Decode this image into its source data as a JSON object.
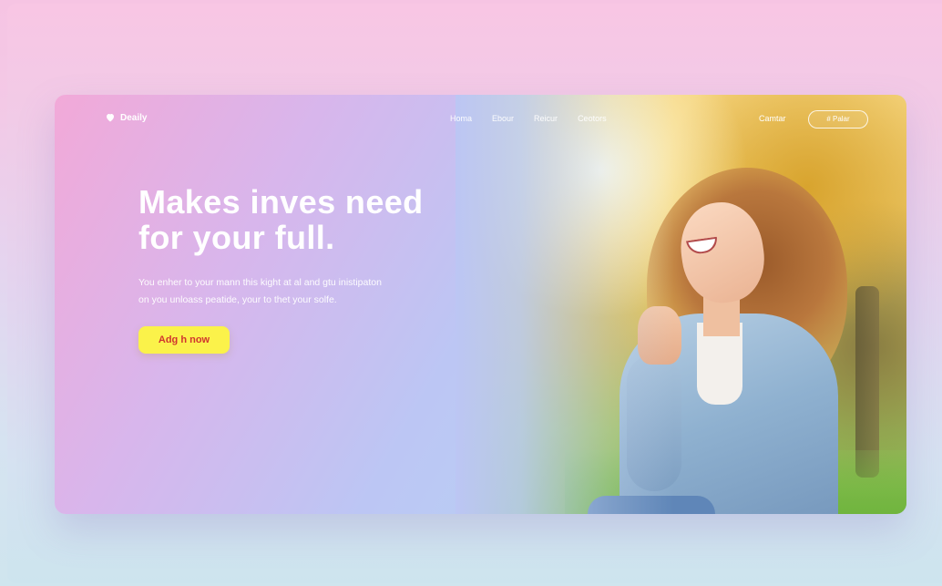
{
  "brand": {
    "name": "Deaily",
    "icon": "heart-icon"
  },
  "nav": {
    "links": [
      "Homa",
      "Ebour",
      "Reicur",
      "Ceotors"
    ],
    "right_link": "Camtar",
    "button_label": "# Palar"
  },
  "hero": {
    "title_line1": "Makes inves need",
    "title_line2": "for your full.",
    "description_line1": "You enher to your mann this kight at al and gtu inistipaton",
    "description_line2": "on you unloass peatide, your to thet your solfe.",
    "cta_label": "Adg h now"
  },
  "colors": {
    "accent_button": "#fbf24a",
    "accent_text": "#d0362e",
    "text": "#ffffff"
  }
}
